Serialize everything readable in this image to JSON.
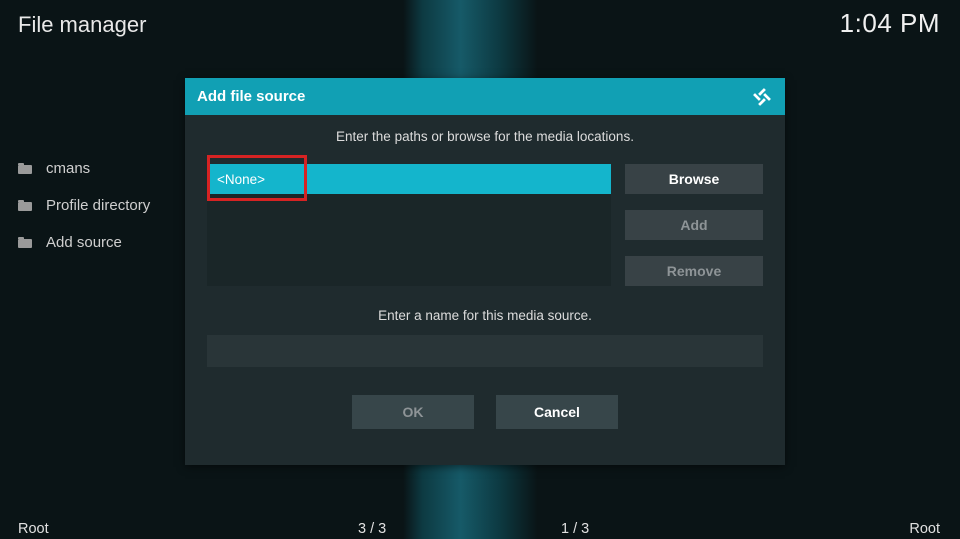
{
  "header": {
    "title": "File manager",
    "clock": "1:04 PM"
  },
  "sidebar": {
    "items": [
      {
        "label": "cmans"
      },
      {
        "label": "Profile directory"
      },
      {
        "label": "Add source"
      }
    ]
  },
  "dialog": {
    "title": "Add file source",
    "instruction": "Enter the paths or browse for the media locations.",
    "paths": [
      "<None>"
    ],
    "buttons": {
      "browse": "Browse",
      "add": "Add",
      "remove": "Remove"
    },
    "name_instruction": "Enter a name for this media source.",
    "name_value": "",
    "actions": {
      "ok": "OK",
      "cancel": "Cancel"
    }
  },
  "footer": {
    "left": "Root",
    "count_left": "3 / 3",
    "count_right": "1 / 3",
    "right": "Root"
  }
}
